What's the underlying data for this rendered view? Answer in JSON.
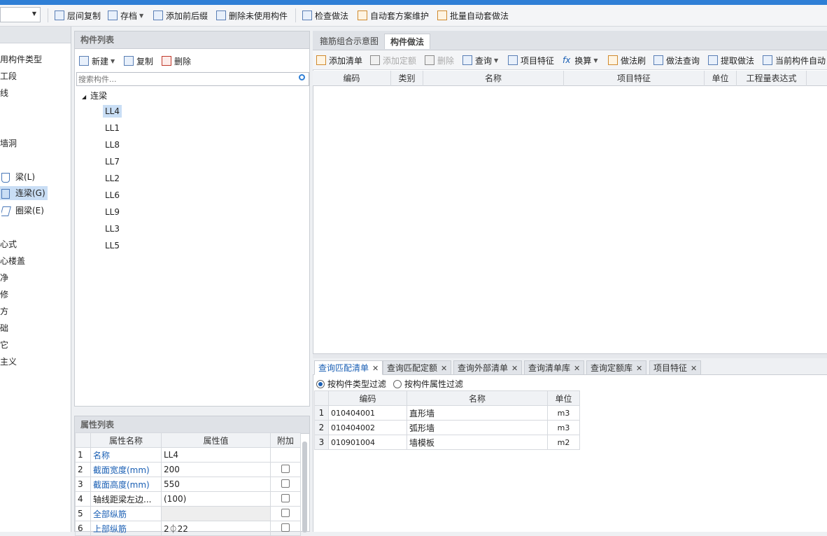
{
  "toolbar": {
    "items": [
      "层间复制",
      "存档",
      "添加前后缀",
      "删除未使用构件",
      "检查做法",
      "自动套方案维护",
      "批量自动套做法"
    ]
  },
  "leftnav": {
    "items": [
      "用构件类型",
      "工段",
      "线",
      "墙洞",
      "梁(L)",
      "连梁(G)",
      "圈梁(E)",
      "心式",
      "心楼盖",
      "净",
      "修",
      "方",
      "础",
      "它",
      "主义"
    ]
  },
  "component_list": {
    "title": "构件列表",
    "buttons": {
      "new": "新建",
      "copy": "复制",
      "delete": "删除"
    },
    "search_placeholder": "搜索构件...",
    "root": "连梁",
    "items": [
      "LL4",
      "LL1",
      "LL8",
      "LL7",
      "LL2",
      "LL6",
      "LL9",
      "LL3",
      "LL5"
    ]
  },
  "property_list": {
    "title": "属性列表",
    "columns": [
      "属性名称",
      "属性值",
      "附加"
    ],
    "rows": [
      {
        "no": "1",
        "name": "名称",
        "value": "LL4"
      },
      {
        "no": "2",
        "name": "截面宽度(mm)",
        "value": "200"
      },
      {
        "no": "3",
        "name": "截面高度(mm)",
        "value": "550"
      },
      {
        "no": "4",
        "name": "轴线距梁左边...",
        "value": "(100)"
      },
      {
        "no": "5",
        "name": "全部纵筋",
        "value": ""
      },
      {
        "no": "6",
        "name": "上部纵筋",
        "value": "2⏀22"
      }
    ]
  },
  "right_tabs": [
    "箍筋组合示意图",
    "构件做法"
  ],
  "right_toolbar": [
    "添加清单",
    "添加定额",
    "删除",
    "查询",
    "项目特征",
    "换算",
    "做法刷",
    "做法查询",
    "提取做法",
    "当前构件自动"
  ],
  "main_grid_columns": [
    "编码",
    "类别",
    "名称",
    "项目特征",
    "单位",
    "工程量表达式"
  ],
  "bottom_tabs": [
    "查询匹配清单",
    "查询匹配定额",
    "查询外部清单",
    "查询清单库",
    "查询定额库",
    "项目特征"
  ],
  "filters": {
    "type": "按构件类型过滤",
    "attr": "按构件属性过滤"
  },
  "match_table": {
    "columns": [
      "编码",
      "名称",
      "单位"
    ],
    "rows": [
      {
        "no": "1",
        "code": "010404001",
        "name": "直形墙",
        "unit": "m3"
      },
      {
        "no": "2",
        "code": "010404002",
        "name": "弧形墙",
        "unit": "m3"
      },
      {
        "no": "3",
        "code": "010901004",
        "name": "墙模板",
        "unit": "m2"
      }
    ]
  }
}
